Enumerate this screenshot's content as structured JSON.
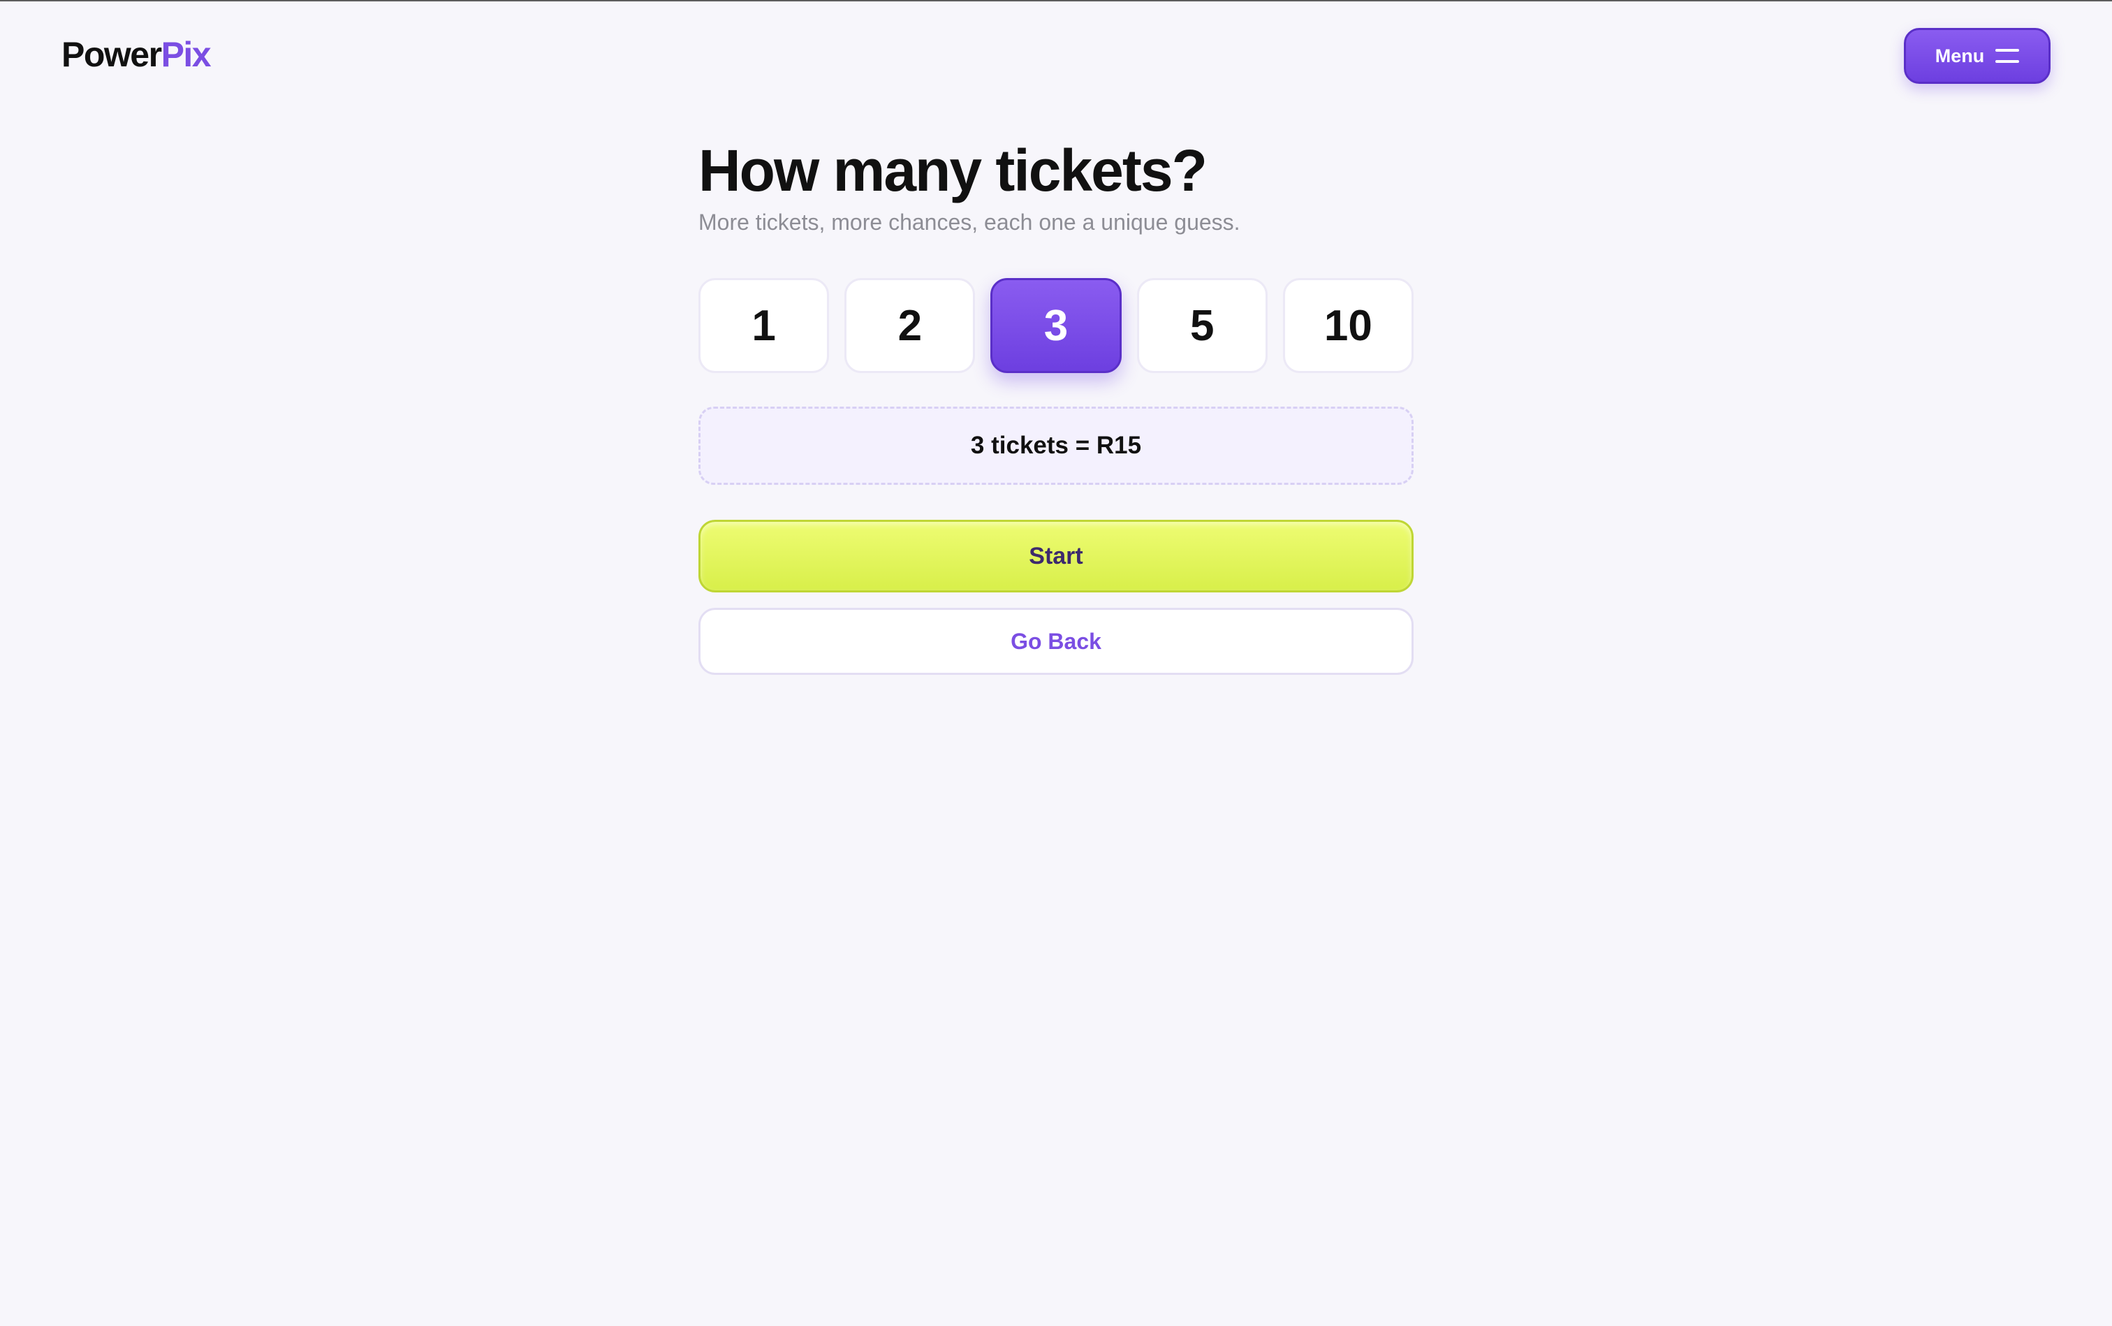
{
  "brand": {
    "logo_primary": "Power",
    "logo_accent": "Pix",
    "accent_color": "#7b4ee3",
    "cta_color": "#e6f75a"
  },
  "header": {
    "menu_label": "Menu",
    "menu_icon": "hamburger-icon"
  },
  "main": {
    "title": "How many tickets?",
    "subtitle": "More tickets, more chances, each one a unique guess.",
    "ticket_options": [
      {
        "label": "1",
        "selected": false
      },
      {
        "label": "2",
        "selected": false
      },
      {
        "label": "3",
        "selected": true
      },
      {
        "label": "5",
        "selected": false
      },
      {
        "label": "10",
        "selected": false
      }
    ],
    "summary": "3 tickets = R15",
    "start_label": "Start",
    "back_label": "Go Back"
  }
}
